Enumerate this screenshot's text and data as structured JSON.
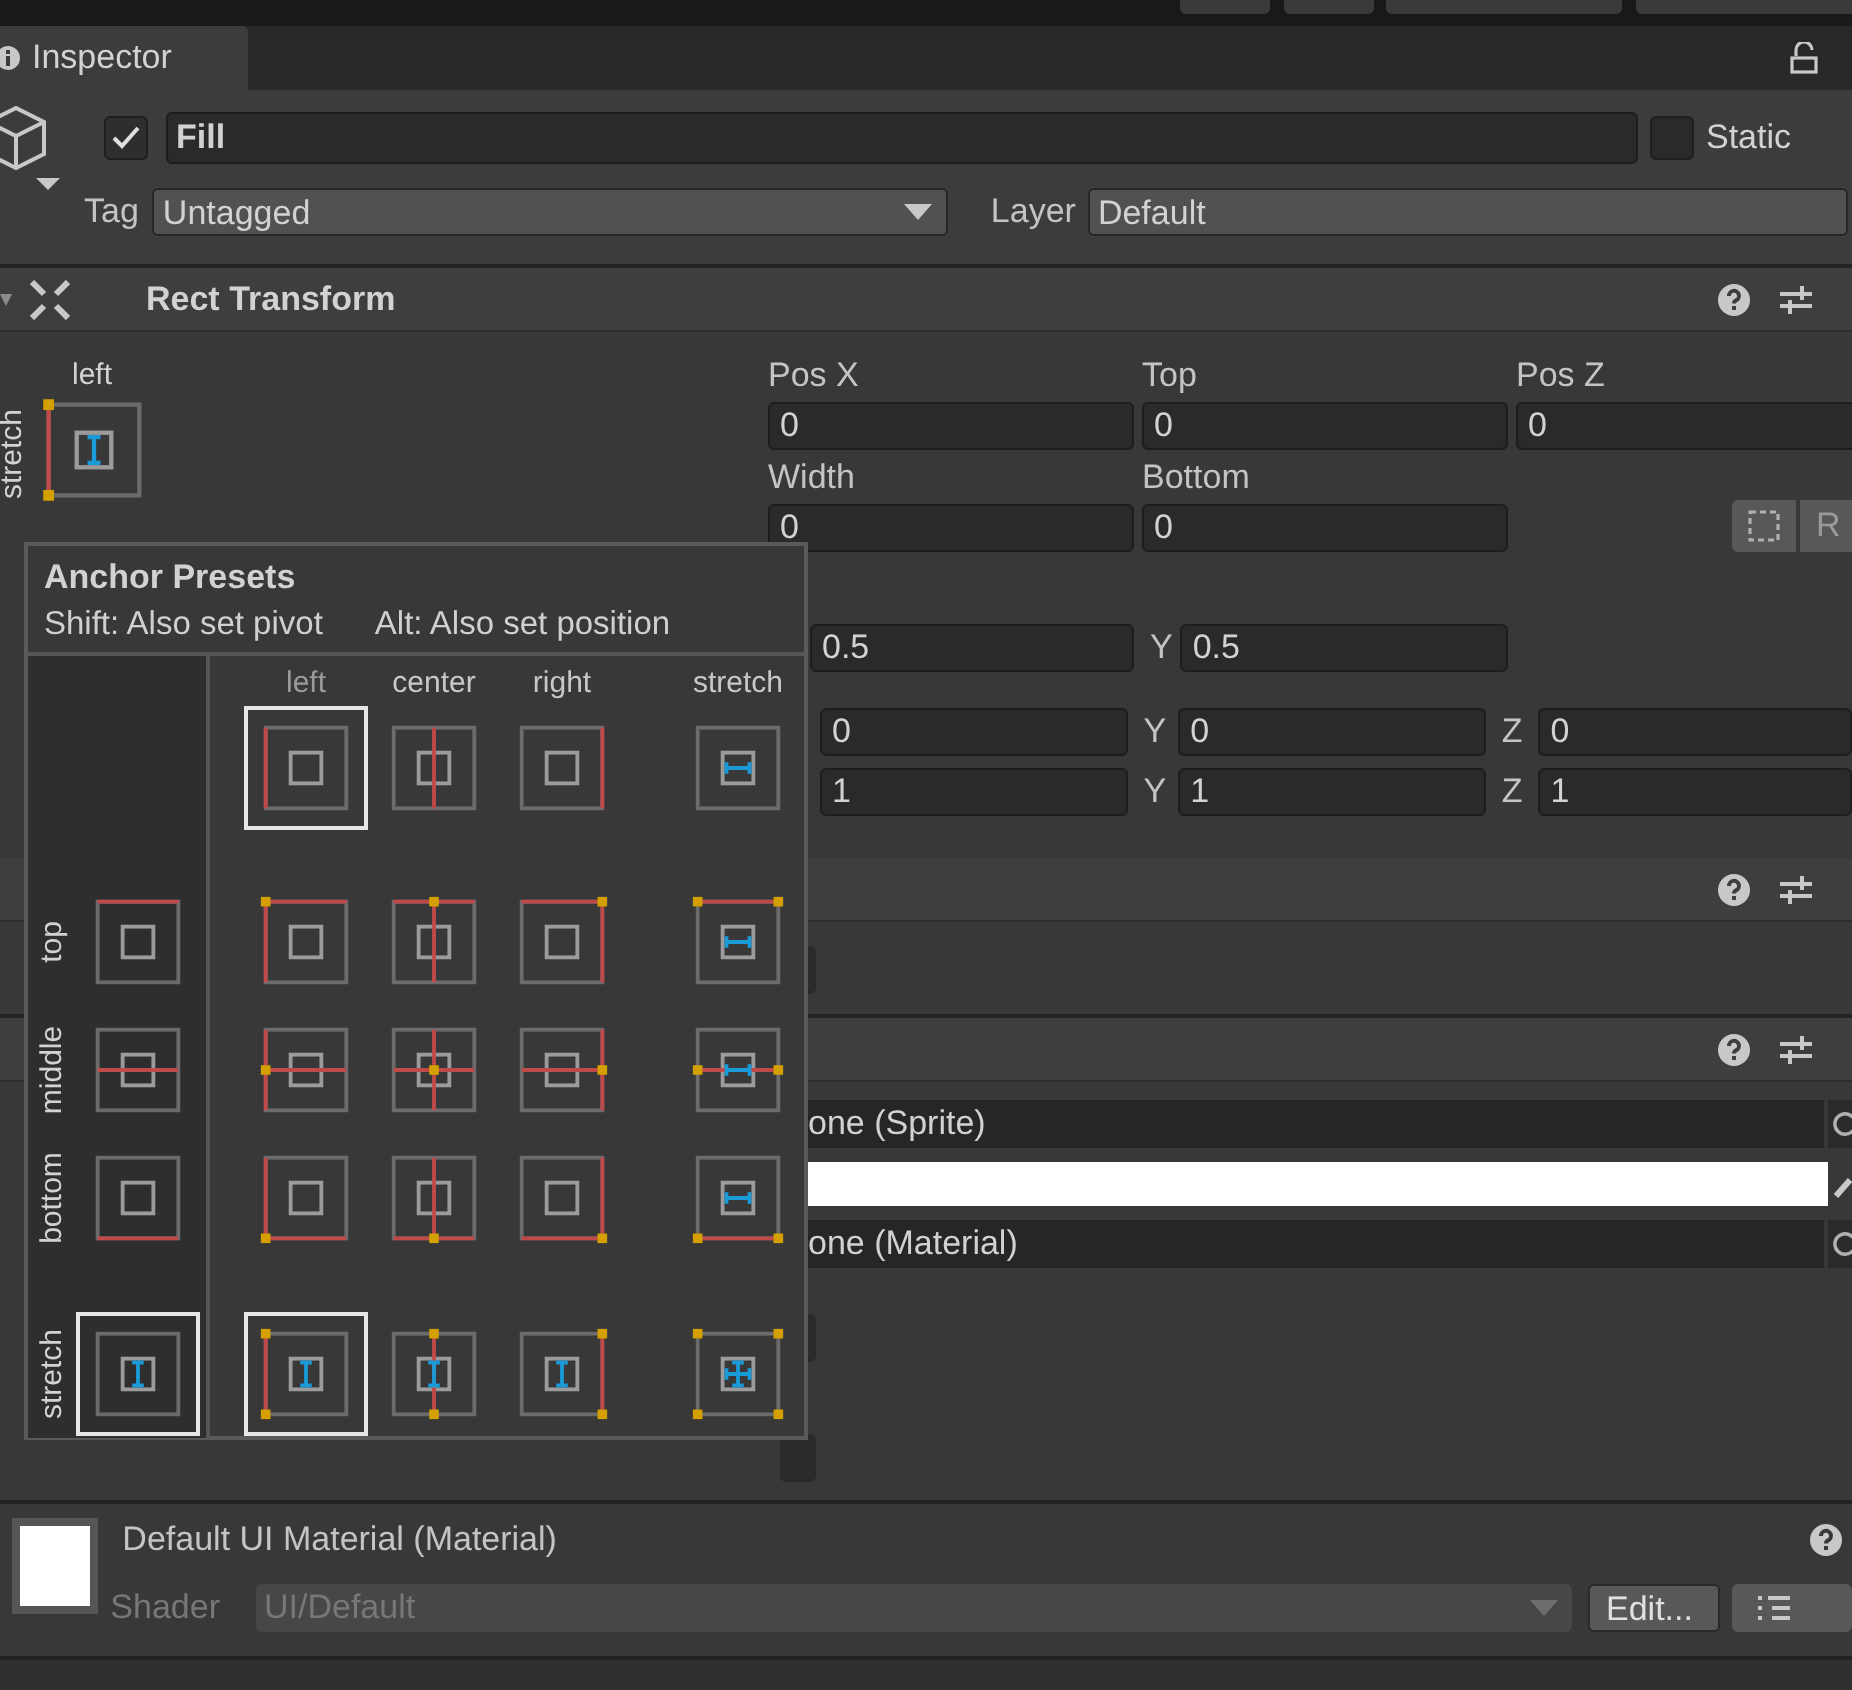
{
  "tab": {
    "label": "Inspector"
  },
  "object": {
    "active": true,
    "name": "Fill",
    "static": false,
    "static_label": "Static",
    "tag_label": "Tag",
    "tag": "Untagged",
    "layer_label": "Layer",
    "layer": "Default"
  },
  "rect_transform": {
    "title": "Rect Transform",
    "anchor_h": "left",
    "anchor_v": "stretch",
    "fields": [
      {
        "label": "Pos X",
        "value": "0"
      },
      {
        "label": "Top",
        "value": "0"
      },
      {
        "label": "Pos Z",
        "value": "0"
      },
      {
        "label": "Width",
        "value": "0"
      },
      {
        "label": "Bottom",
        "value": "0"
      }
    ],
    "raw_button": "R",
    "pivot": [
      {
        "value": "0.5"
      },
      {
        "label": "Y",
        "value": "0.5"
      }
    ],
    "rotation": [
      {
        "value": "0"
      },
      {
        "label": "Y",
        "value": "0"
      },
      {
        "label": "Z",
        "value": "0"
      }
    ],
    "scale": [
      {
        "value": "1"
      },
      {
        "label": "Y",
        "value": "1"
      },
      {
        "label": "Z",
        "value": "1"
      }
    ]
  },
  "image": {
    "source": "one (Sprite)",
    "color": "#ffffff",
    "material": "one (Material)"
  },
  "material": {
    "title": "Default UI Material (Material)",
    "shader_label": "Shader",
    "shader": "UI/Default",
    "edit_button": "Edit..."
  },
  "anchor_presets": {
    "title": "Anchor Presets",
    "hints": [
      "Shift: Also set pivot",
      "Alt: Also set position"
    ],
    "columns": [
      {
        "label": "left",
        "selected": true
      },
      {
        "label": "center",
        "selected": false
      },
      {
        "label": "right",
        "selected": false
      },
      {
        "label": "stretch",
        "selected": false
      }
    ],
    "rows": [
      {
        "label": "top",
        "selected": false,
        "cells": [
          {
            "selected": false
          },
          {
            "selected": false
          },
          {
            "selected": false
          },
          {
            "selected": false
          }
        ]
      },
      {
        "label": "middle",
        "selected": false,
        "cells": [
          {
            "selected": false
          },
          {
            "selected": false
          },
          {
            "selected": false
          },
          {
            "selected": false
          }
        ]
      },
      {
        "label": "bottom",
        "selected": false,
        "cells": [
          {
            "selected": false
          },
          {
            "selected": false
          },
          {
            "selected": false
          },
          {
            "selected": false
          }
        ]
      },
      {
        "label": "stretch",
        "selected": true,
        "cells": [
          {
            "selected": true
          },
          {
            "selected": false
          },
          {
            "selected": false
          },
          {
            "selected": false
          }
        ]
      }
    ]
  }
}
